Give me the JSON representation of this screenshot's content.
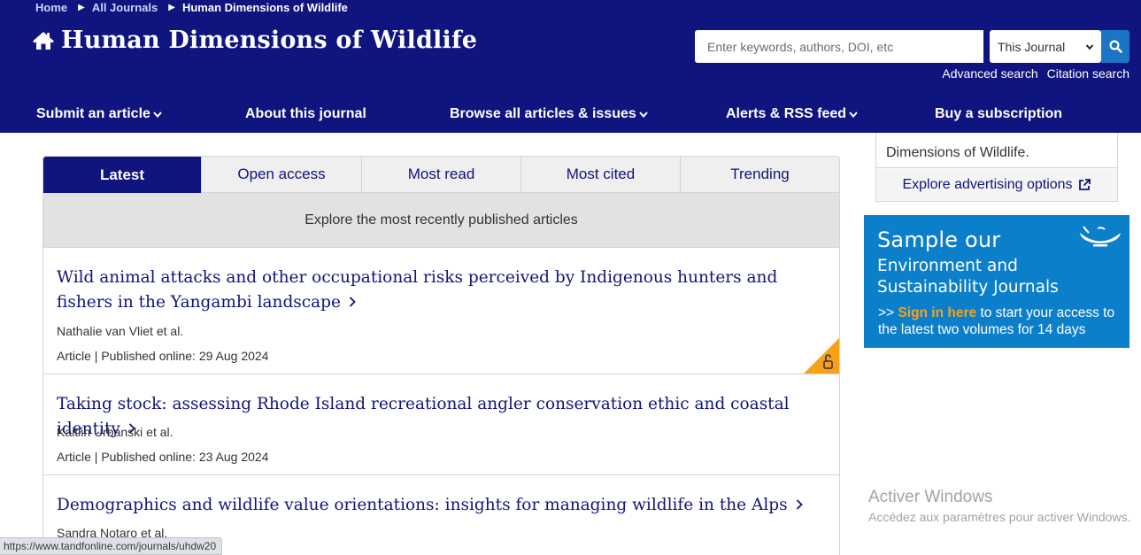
{
  "breadcrumb": {
    "home": "Home",
    "all_journals": "All Journals",
    "current": "Human Dimensions of Wildlife"
  },
  "header": {
    "title": "Human Dimensions of Wildlife"
  },
  "search": {
    "placeholder": "Enter keywords, authors, DOI, etc",
    "scope": "This Journal",
    "advanced": "Advanced search",
    "citation": "Citation search"
  },
  "nav": {
    "submit": "Submit an article",
    "about": "About this journal",
    "browse": "Browse all articles & issues",
    "alerts": "Alerts & RSS feed",
    "buy": "Buy a subscription"
  },
  "tabs": {
    "latest": "Latest",
    "open_access": "Open access",
    "most_read": "Most read",
    "most_cited": "Most cited",
    "trending": "Trending"
  },
  "tab_description": "Explore the most recently published articles",
  "articles": [
    {
      "title": "Wild animal attacks and other occupational risks perceived by Indigenous hunters and fishers in the Yangambi landscape",
      "authors": "Nathalie van Vliet et al.",
      "meta": "Article | Published online: 29 Aug 2024",
      "open_access": true
    },
    {
      "title": "Taking stock: assessing Rhode Island recreational angler conservation ethic and coastal identity",
      "authors": "Kaitlin Urbanski et al.",
      "meta": "Article | Published online: 23 Aug 2024",
      "open_access": false
    },
    {
      "title": "Demographics and wildlife value orientations: insights for managing wildlife in the Alps",
      "authors": "Sandra Notaro et al.",
      "meta": "",
      "open_access": false
    }
  ],
  "sidebar": {
    "ad_text": "Dimensions of Wildlife.",
    "ad_link": "Explore advertising options",
    "promo": {
      "sample": "Sample our",
      "subtitle": "Environment and Sustainability Journals",
      "cta_prefix": ">> ",
      "sign_in": "Sign in here",
      "cta_rest": " to start your access to the latest two volumes for 14 days"
    }
  },
  "system": {
    "watermark_title": "Activer Windows",
    "watermark_sub": "Accédez aux paramètres pour activer Windows.",
    "status_url": "https://www.tandfonline.com/journals/uhdw20"
  },
  "colors": {
    "brand_navy": "#10147e",
    "accent_blue": "#1b75c7",
    "promo_blue": "#0c7fcb",
    "oa_orange": "#f7a11a"
  }
}
